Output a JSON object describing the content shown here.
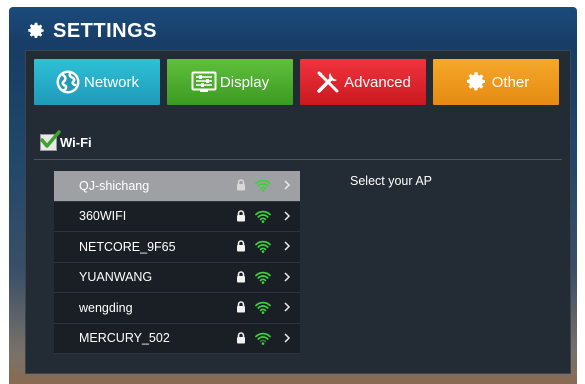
{
  "header": {
    "title": "SETTINGS",
    "icon": "gear-icon"
  },
  "tabs": [
    {
      "label": "Network",
      "icon": "globe-icon",
      "color": "#24aac9"
    },
    {
      "label": "Display",
      "icon": "display-sliders-icon",
      "color": "#4fb030"
    },
    {
      "label": "Advanced",
      "icon": "tools-icon",
      "color": "#e0262e"
    },
    {
      "label": "Other",
      "icon": "gear-icon",
      "color": "#f09a1e"
    }
  ],
  "wifi": {
    "label": "Wi-Fi",
    "checked": true
  },
  "access_points": [
    {
      "name": "QJ-shichang",
      "selected": true,
      "locked": true
    },
    {
      "name": "360WIFI",
      "selected": false,
      "locked": true
    },
    {
      "name": "NETCORE_9F65",
      "selected": false,
      "locked": true
    },
    {
      "name": "YUANWANG",
      "selected": false,
      "locked": true
    },
    {
      "name": "wengding",
      "selected": false,
      "locked": true
    },
    {
      "name": "MERCURY_502",
      "selected": false,
      "locked": true
    }
  ],
  "detail": {
    "hint": "Select your AP"
  },
  "colors": {
    "signal": "#39d43b",
    "panel": "#232b34",
    "selected_row": "#9ea0a3"
  }
}
